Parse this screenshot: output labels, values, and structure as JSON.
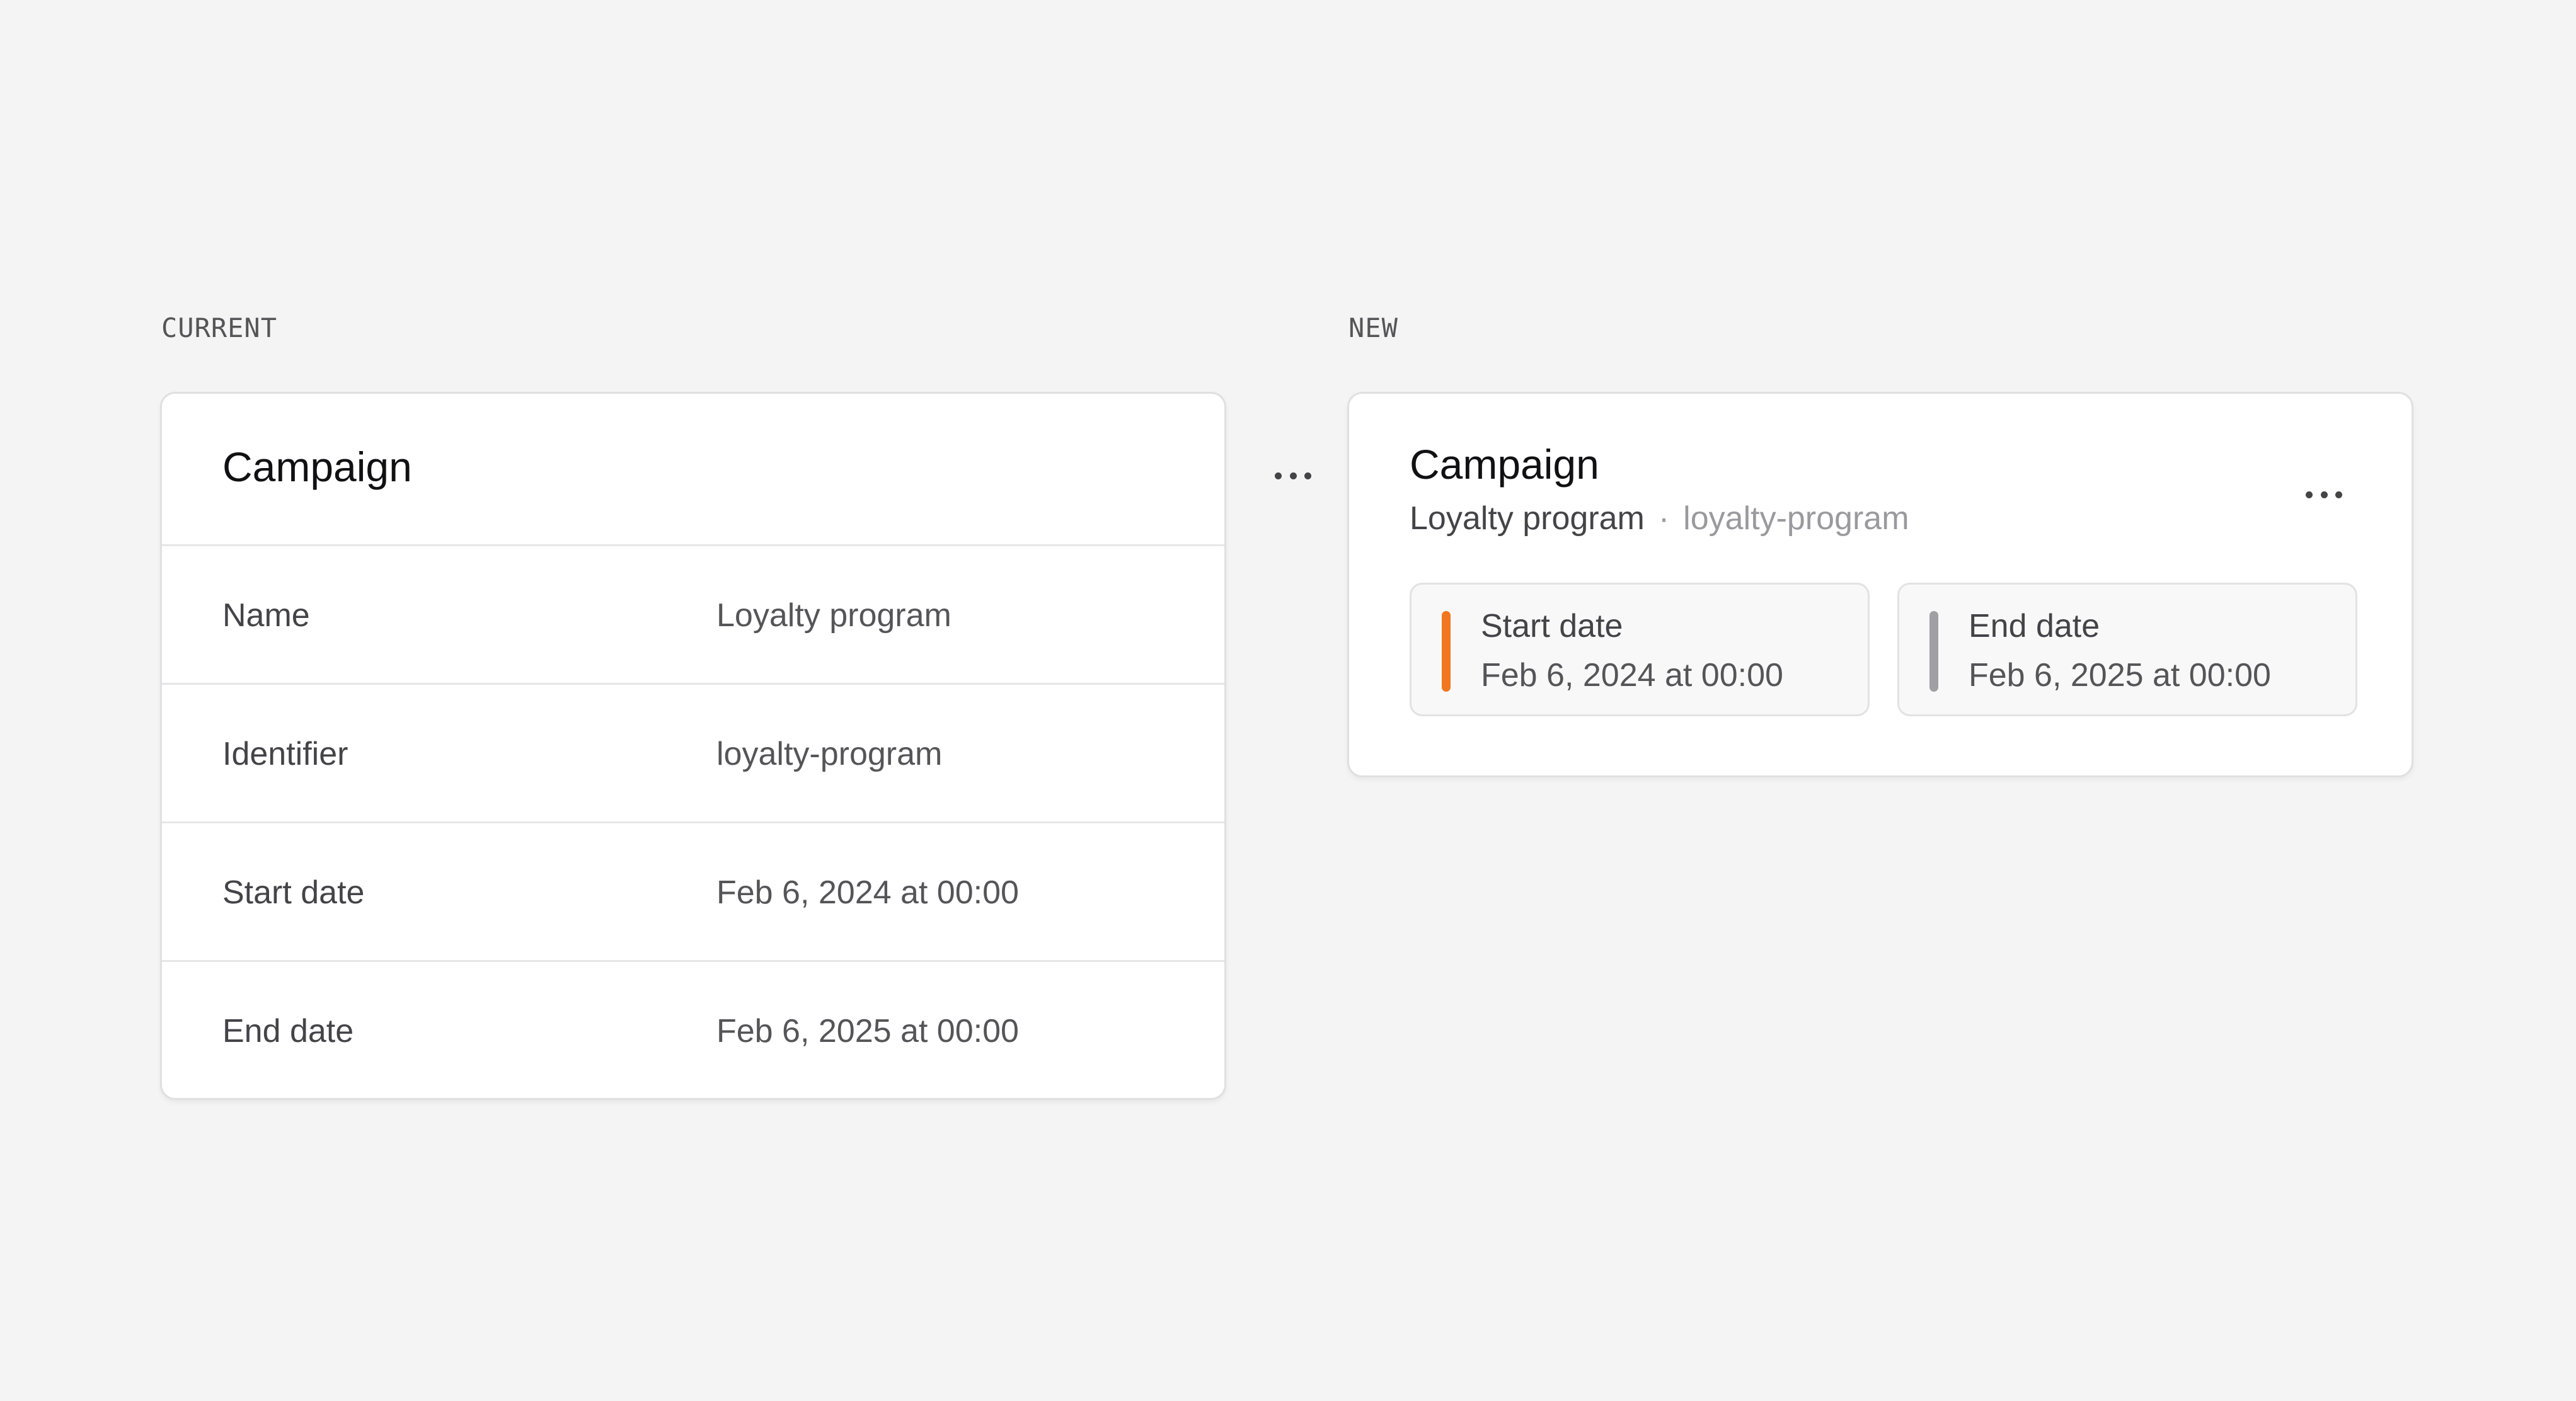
{
  "sections": {
    "current_label": "CURRENT",
    "new_label": "NEW"
  },
  "current_card": {
    "title": "Campaign",
    "menu_icon": "more-horizontal-icon",
    "rows": [
      {
        "label": "Name",
        "value": "Loyalty program"
      },
      {
        "label": "Identifier",
        "value": "loyalty-program"
      },
      {
        "label": "Start date",
        "value": "Feb 6, 2024 at 00:00"
      },
      {
        "label": "End date",
        "value": "Feb 6, 2025 at 00:00"
      }
    ]
  },
  "new_card": {
    "title": "Campaign",
    "name": "Loyalty program",
    "separator": "·",
    "identifier": "loyalty-program",
    "menu_icon": "more-horizontal-icon",
    "start": {
      "label": "Start date",
      "value": "Feb 6, 2024 at 00:00",
      "accent_color": "#f07820"
    },
    "end": {
      "label": "End date",
      "value": "Feb 6, 2025 at 00:00",
      "accent_color": "#a0a0a4"
    }
  }
}
